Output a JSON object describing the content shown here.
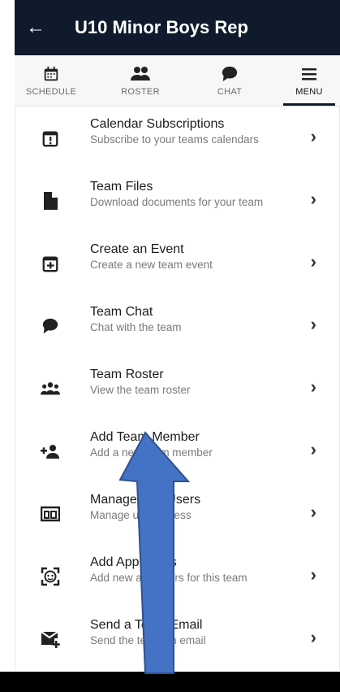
{
  "header": {
    "back_glyph": "←",
    "title": "U10 Minor Boys Rep"
  },
  "tabs": [
    {
      "label": "SCHEDULE",
      "icon": "calendar-icon"
    },
    {
      "label": "ROSTER",
      "icon": "people-icon"
    },
    {
      "label": "CHAT",
      "icon": "chat-bubble-icon"
    },
    {
      "label": "MENU",
      "icon": "hamburger-menu-icon",
      "active": true
    }
  ],
  "menu": {
    "items": [
      {
        "title": "Calendar Subscriptions",
        "subtitle": "Subscribe to your teams calendars",
        "icon": "calendar-alert-icon"
      },
      {
        "title": "Team Files",
        "subtitle": "Download documents for your team",
        "icon": "file-icon"
      },
      {
        "title": "Create an Event",
        "subtitle": "Create a new team event",
        "icon": "calendar-plus-icon"
      },
      {
        "title": "Team Chat",
        "subtitle": "Chat with the team",
        "icon": "chat-bubble-icon"
      },
      {
        "title": "Team Roster",
        "subtitle": "View the team roster",
        "icon": "people-icon"
      },
      {
        "title": "Add Team Member",
        "subtitle": "Add a new team member",
        "icon": "person-add-icon"
      },
      {
        "title": "Manage App Users",
        "subtitle": "Manage user access",
        "icon": "devices-icon"
      },
      {
        "title": "Add App Users",
        "subtitle": "Add new app users for this team",
        "icon": "face-scan-icon"
      },
      {
        "title": "Send a Team Email",
        "subtitle": "Send the team an email",
        "icon": "email-send-icon"
      }
    ],
    "chevron": "›"
  },
  "colors": {
    "header_bg": "#0f1b2d",
    "annotation_arrow": "#4472c4"
  }
}
